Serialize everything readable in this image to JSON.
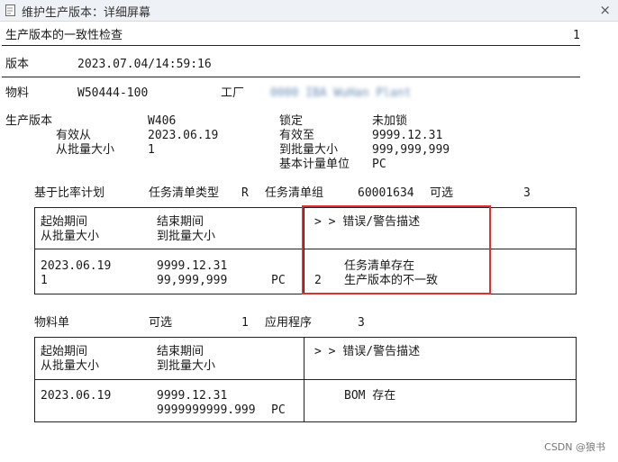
{
  "window": {
    "title": "维护生产版本：详细屏幕",
    "close_symbol": "×"
  },
  "header": {
    "title": "生产版本的一致性检查",
    "page": "1"
  },
  "version": {
    "label": "版本",
    "value": "2023.07.04/14:59:16"
  },
  "material": {
    "label": "物料",
    "value": "W50444-100",
    "plant_label": "工厂",
    "plant_value": "0000 IBA WuHan Plant"
  },
  "prod_version": {
    "label": "生产版本",
    "value": "W406",
    "valid_from_label": "有效从",
    "valid_from": "2023.06.19",
    "from_lot_label": "从批量大小",
    "from_lot": "1",
    "lock_label": "锁定",
    "lock_value": "未加锁",
    "valid_to_label": "有效至",
    "valid_to": "9999.12.31",
    "to_lot_label": "到批量大小",
    "to_lot": "999,999,999",
    "base_unit_label": "基本计量单位",
    "base_unit": "PC"
  },
  "routing": {
    "rate_label": "基于比率计划",
    "type_label": "任务清单类型",
    "type_value": "R",
    "group_label": "任务清单组",
    "group_value": "60001634",
    "optional_label": "可选",
    "optional_value": "3",
    "table": {
      "h_start": "起始期间",
      "h_from_lot": "从批量大小",
      "h_end": "结束期间",
      "h_to_lot": "到批量大小",
      "h_msg": "> > 错误/警告描述",
      "r_start": "2023.06.19",
      "r_from_lot": "1",
      "r_end": "9999.12.31",
      "r_to_lot": "99,999,999",
      "r_unit": "PC",
      "r_code": "2",
      "r_msg1": "任务清单存在",
      "r_msg2": "生产版本的不一致"
    }
  },
  "bom": {
    "label": "物料单",
    "optional_label": "可选",
    "optional_value": "1",
    "app_label": "应用程序",
    "app_value": "3",
    "table": {
      "h_start": "起始期间",
      "h_from_lot": "从批量大小",
      "h_end": "结束期间",
      "h_to_lot": "到批量大小",
      "h_msg": "> > 错误/警告描述",
      "r_start": "2023.06.19",
      "r_end": "9999.12.31",
      "r_to_lot": "9999999999.999",
      "r_unit": "PC",
      "r_msg": "BOM 存在"
    }
  },
  "watermark": "CSDN @狼书"
}
